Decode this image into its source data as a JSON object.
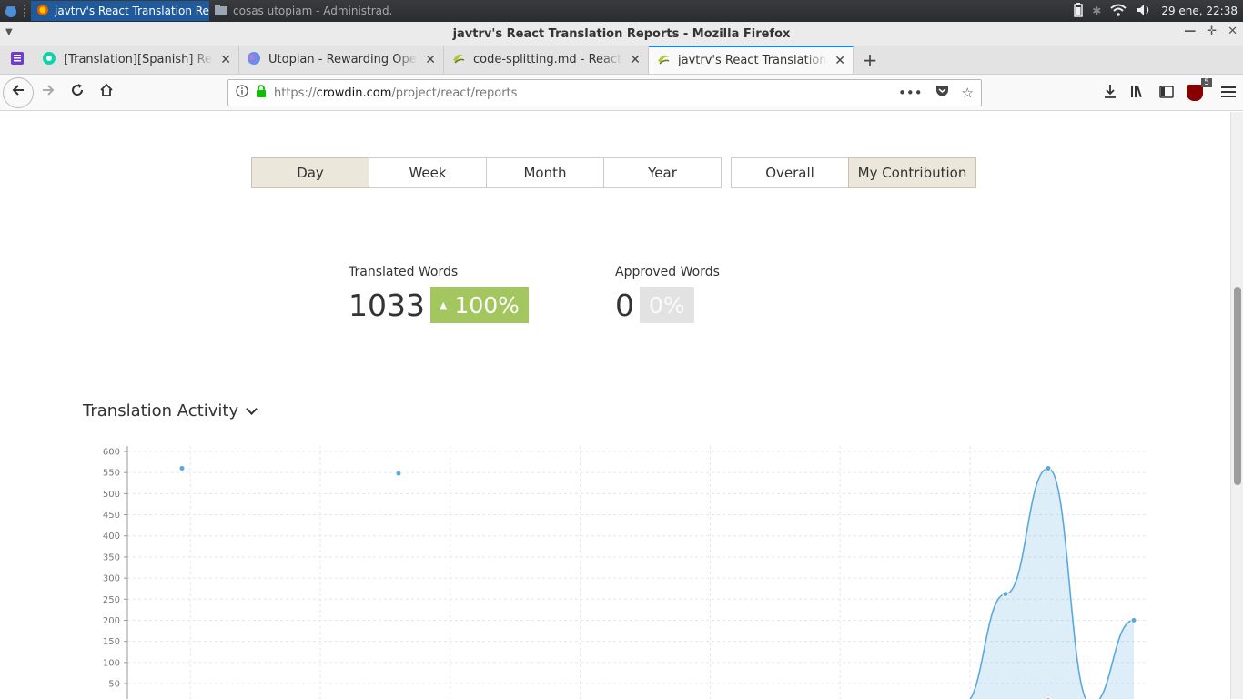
{
  "taskbar": {
    "task_active": "javtrv's React Translation Re...",
    "task_inactive": "cosas utopiam - Administrad...",
    "clock": "29 ene, 22:38"
  },
  "window": {
    "title": "javtrv's React Translation Reports - Mozilla Firefox"
  },
  "tabs": [
    {
      "label": "[Translation][Spanish] React (",
      "icon": "steemit-icon"
    },
    {
      "label": "Utopian - Rewarding Open So",
      "icon": "utopian-icon"
    },
    {
      "label": "code-splitting.md - React - Cro",
      "icon": "crowdin-icon"
    },
    {
      "label": "javtrv's React Translation Rep",
      "icon": "crowdin-icon",
      "active": true
    }
  ],
  "urlbar": {
    "prefix": "https://",
    "host": "crowdin.com",
    "path": "/project/react/reports"
  },
  "ublock_badge": "5",
  "period_buttons": [
    {
      "label": "Day",
      "active": true
    },
    {
      "label": "Week",
      "active": false
    },
    {
      "label": "Month",
      "active": false
    },
    {
      "label": "Year",
      "active": false
    }
  ],
  "scope_buttons": [
    {
      "label": "Overall",
      "active": false
    },
    {
      "label": "My Contribution",
      "active": true
    }
  ],
  "stats": {
    "translated": {
      "label": "Translated Words",
      "value": "1033",
      "change": "100%",
      "arrow": "▲"
    },
    "approved": {
      "label": "Approved Words",
      "value": "0",
      "change": "0%"
    }
  },
  "section": {
    "title": "Translation Activity"
  },
  "colors": {
    "translated": "#5aa9dc",
    "approved": "#e8875a",
    "active_button": "#ebe7da",
    "up_badge": "#a3c65f"
  },
  "chart_data": {
    "type": "area",
    "title": "",
    "xlabel": "",
    "ylabel": "",
    "ylim": [
      0,
      600
    ],
    "yticks": [
      50,
      100,
      150,
      200,
      250,
      300,
      350,
      400,
      450,
      500,
      550,
      600
    ],
    "grid": true,
    "series": [
      {
        "values": [
          560,
          0,
          548,
          0,
          0,
          0,
          0,
          0,
          0,
          0,
          0,
          0,
          0,
          0,
          0,
          0,
          0,
          0,
          0,
          0,
          0,
          0,
          0,
          0,
          0,
          0,
          0,
          0,
          0,
          0,
          0,
          0,
          0,
          0,
          0,
          0,
          0,
          0,
          0,
          0,
          0,
          0,
          0,
          0,
          0,
          0,
          262,
          560,
          0,
          200
        ]
      },
      {
        "values": [
          0,
          0,
          0,
          0,
          0,
          0,
          0,
          0,
          0,
          0,
          0,
          0,
          0,
          0,
          0,
          0,
          0,
          0,
          0,
          0,
          0,
          0,
          0,
          0,
          0,
          0,
          0,
          0,
          0,
          0,
          0,
          0,
          0,
          0,
          0,
          0,
          0,
          0,
          0,
          0,
          0,
          0,
          0,
          0,
          0,
          0,
          0,
          10,
          0,
          0
        ]
      }
    ],
    "visible_points": [
      {
        "x_index": 0,
        "series": 0,
        "value": 560
      },
      {
        "x_index": 2,
        "series": 0,
        "value": 548
      },
      {
        "x_index": 46,
        "series": 0,
        "value": 262
      },
      {
        "x_index": 47,
        "series": 0,
        "value": 560
      },
      {
        "x_index": 48,
        "series": 0,
        "value": 0
      },
      {
        "x_index": 49,
        "series": 0,
        "value": 200
      },
      {
        "x_index": 0,
        "series": 1,
        "value": 0
      },
      {
        "x_index": 2,
        "series": 1,
        "value": 0
      },
      {
        "x_index": 46,
        "series": 1,
        "value": 0
      },
      {
        "x_index": 47,
        "series": 1,
        "value": 10
      }
    ]
  }
}
